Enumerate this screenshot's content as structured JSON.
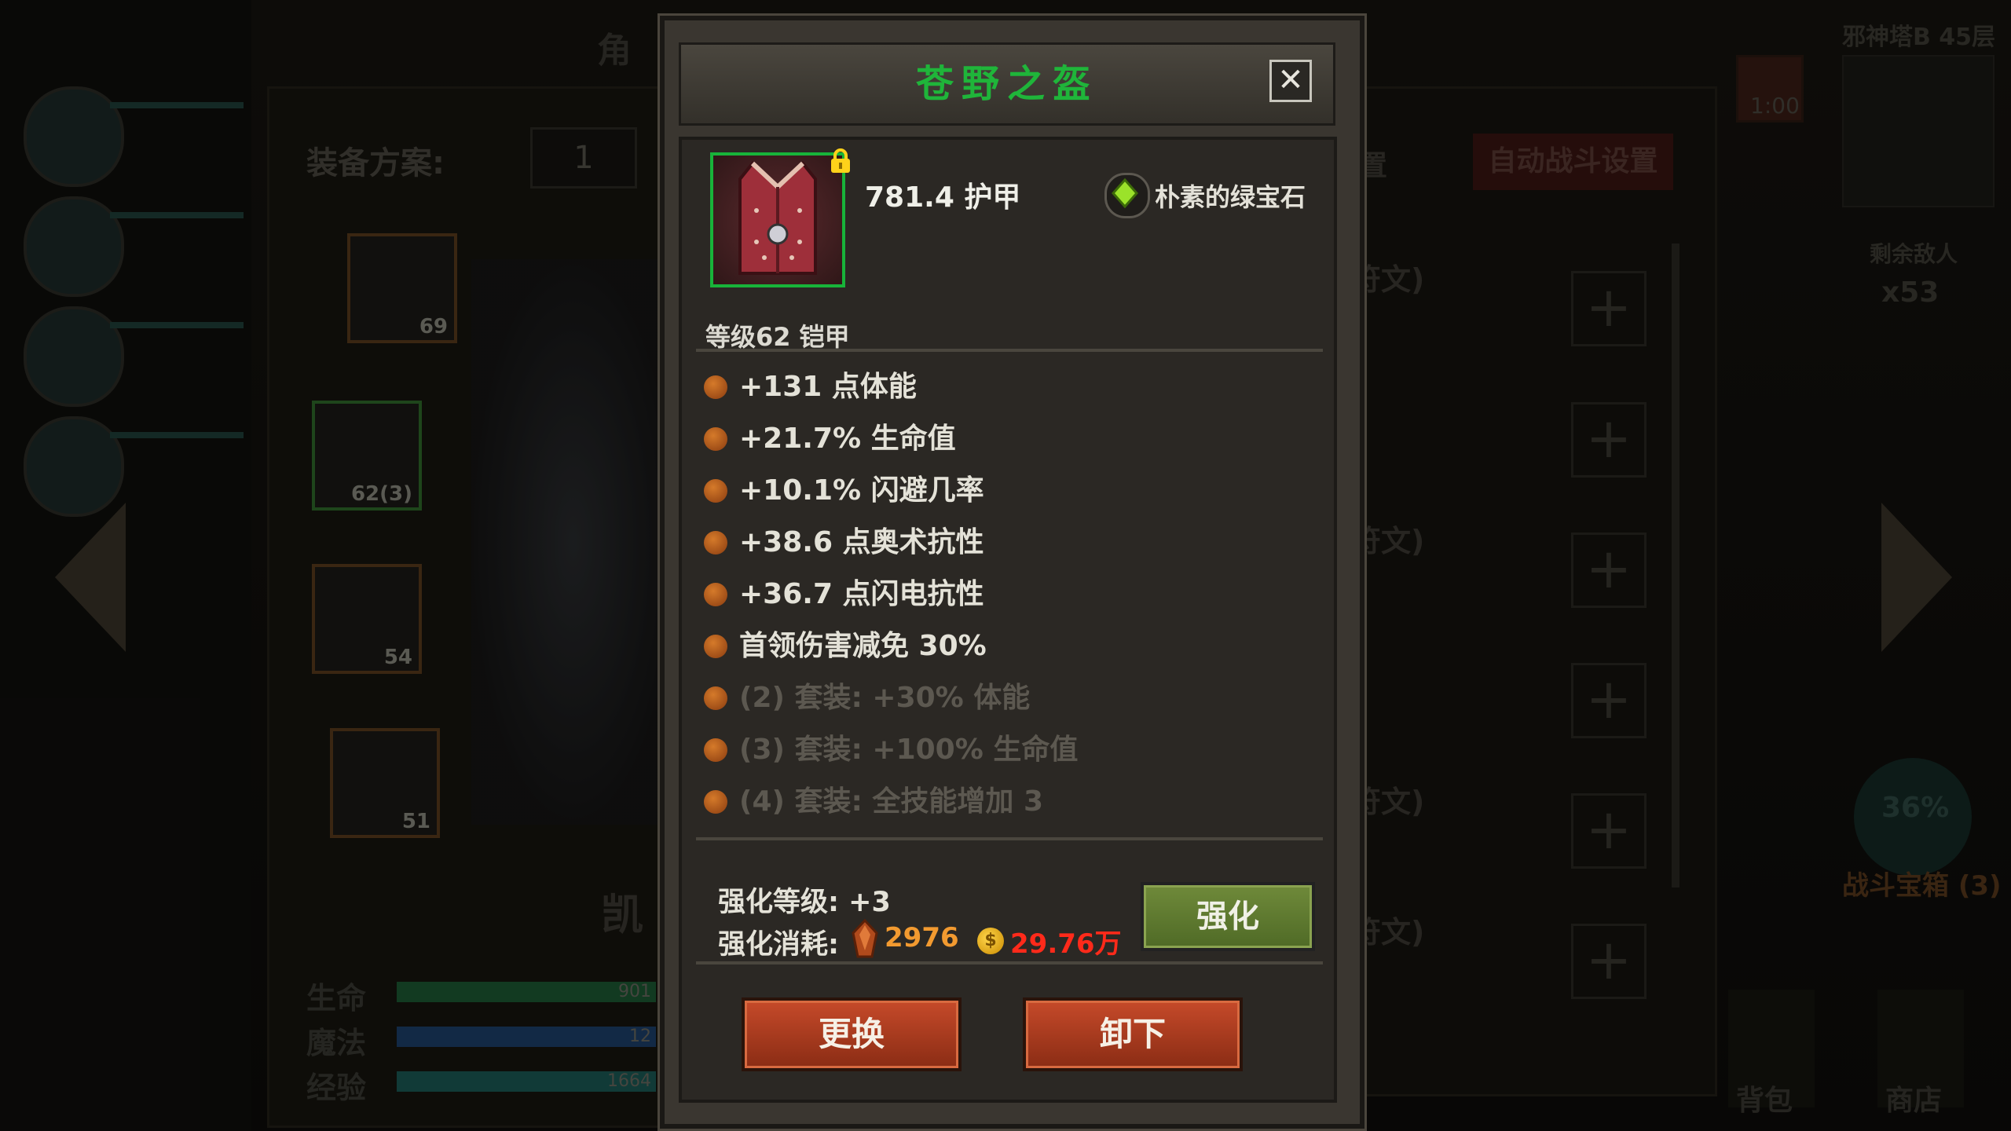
{
  "dialog": {
    "title": "苍野之盔",
    "close_label": "✕",
    "armor_value": "781.4 护甲",
    "gem_name": "朴素的绿宝石",
    "level_type": "等级62 铠甲",
    "attributes": [
      {
        "text": "+131 点体能",
        "active": true
      },
      {
        "text": "+21.7% 生命值",
        "active": true
      },
      {
        "text": "+10.1% 闪避几率",
        "active": true
      },
      {
        "text": "+38.6 点奥术抗性",
        "active": true
      },
      {
        "text": "+36.7 点闪电抗性",
        "active": true
      },
      {
        "text": "首领伤害减免 30%",
        "active": true
      },
      {
        "text": "(2) 套装: +30% 体能",
        "active": false
      },
      {
        "text": "(3) 套装: +100% 生命值",
        "active": false
      },
      {
        "text": "(4) 套装: 全技能增加 3",
        "active": false
      }
    ],
    "enhance_level_label": "强化等级: +3",
    "enhance_cost_label": "强化消耗:",
    "enhance_cost_stone": "2976",
    "enhance_cost_gold": "29.76万",
    "enhance_button": "强化",
    "replace_button": "更换",
    "unequip_button": "卸下"
  },
  "background": {
    "equip_plan_label": "装备方案:",
    "equip_plan_value": "1",
    "tab_partial": "角",
    "hero_name_partial": "凯",
    "slots": [
      {
        "level": "69"
      },
      {
        "level": "62(3)"
      },
      {
        "level": "54"
      },
      {
        "level": "51"
      }
    ],
    "stats": [
      {
        "label": "生命",
        "value": "901",
        "color": "#1d5a34"
      },
      {
        "label": "魔法",
        "value": "12",
        "color": "#1c3f6a"
      },
      {
        "label": "经验",
        "value": "1664",
        "color": "#1b5a55"
      }
    ],
    "top_right_text": "邪神塔B 45层",
    "timer": "1:00",
    "auto_battle_button": "自动战斗设置",
    "settings_partial": "置",
    "remaining_enemies_label": "剩余敌人",
    "remaining_enemies_count": "x53",
    "battle_chest_percent": "36%",
    "battle_chest_label": "战斗宝箱 (3)",
    "backpack_label": "背包",
    "shop_label": "商店",
    "rune_slots": [
      "符文)",
      ")",
      "符文)",
      ")",
      "符文)",
      "符文)"
    ]
  },
  "colors": {
    "title_green": "#1fb53a",
    "gold_cost": "#ff2a1a",
    "stone_cost": "#f29a30"
  }
}
